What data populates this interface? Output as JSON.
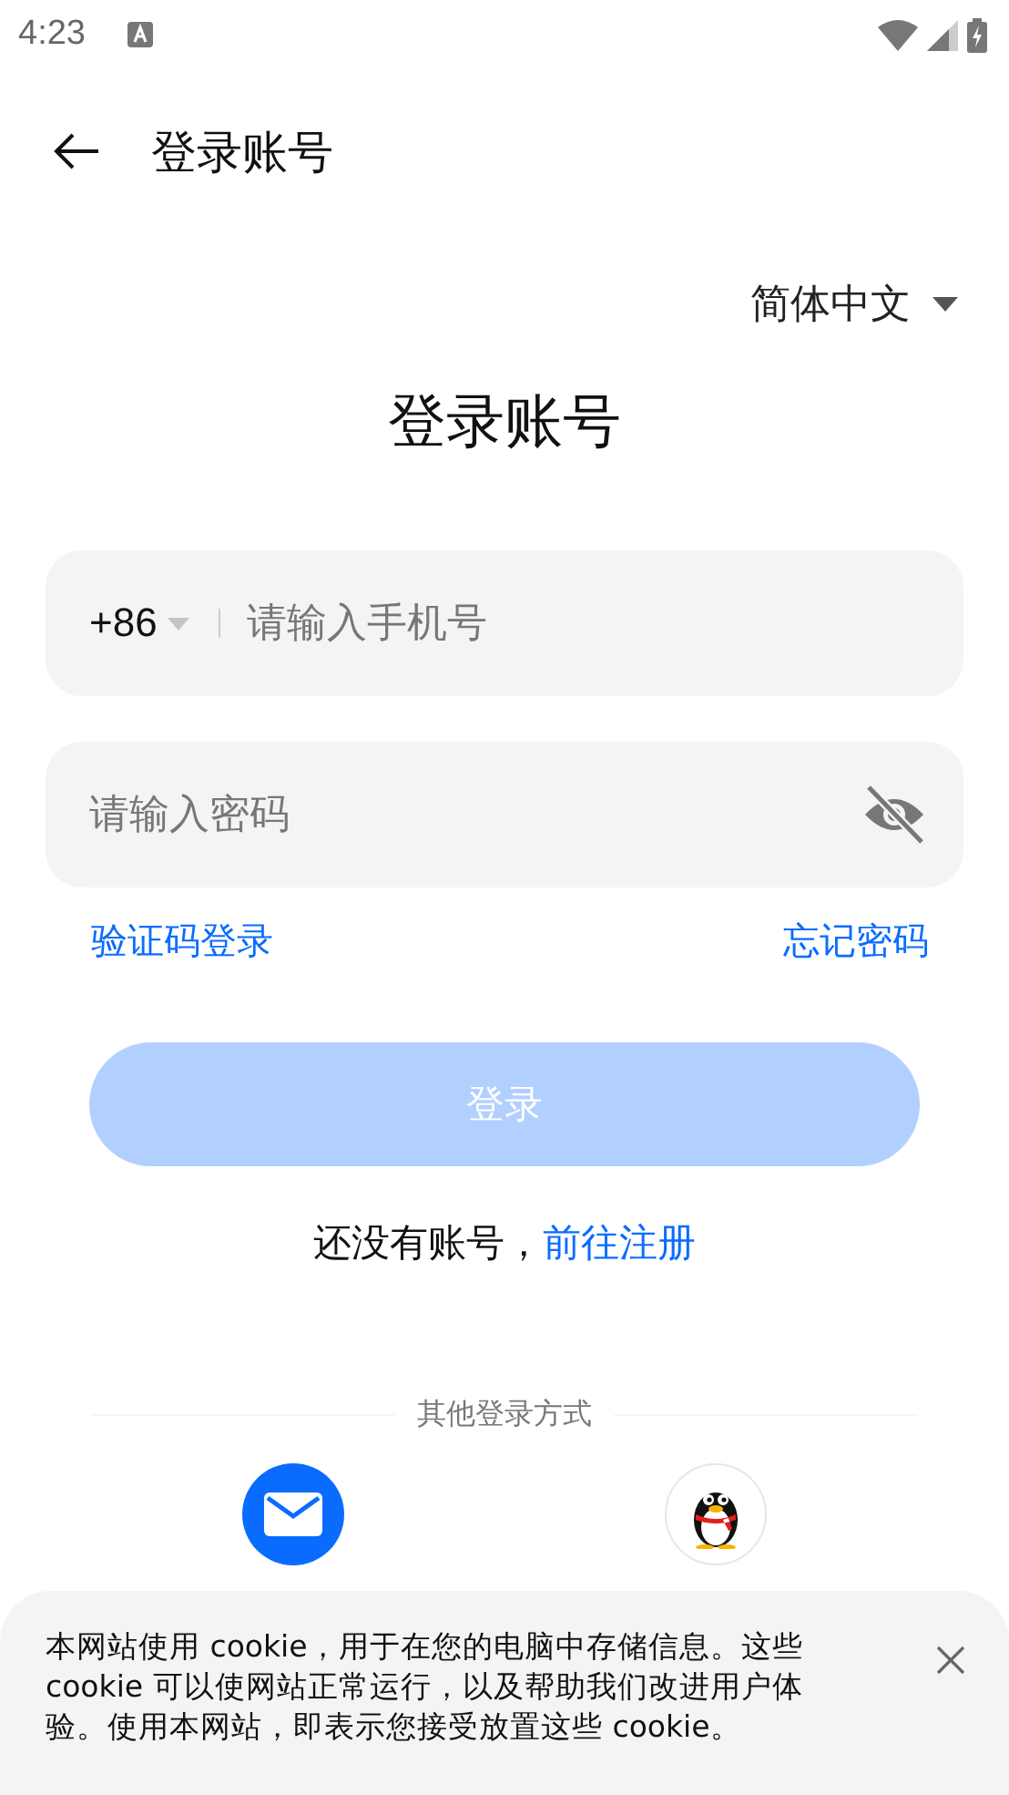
{
  "status_bar": {
    "time": "4:23"
  },
  "header": {
    "title": "登录账号"
  },
  "language": {
    "label": "简体中文"
  },
  "title": "登录账号",
  "phone": {
    "country_code": "+86",
    "placeholder": "请输入手机号"
  },
  "password": {
    "placeholder": "请输入密码",
    "visible": false
  },
  "links": [
    "验证码登录",
    "忘记密码"
  ],
  "login_button": {
    "label": "登录",
    "disabled": true
  },
  "register": {
    "prompt": "还没有账号，",
    "link": "前往注册"
  },
  "other_login": {
    "label": "其他登录方式",
    "methods": [
      {
        "kind": "email"
      },
      {
        "kind": "qq"
      }
    ]
  },
  "cookie_banner": {
    "text": "本网站使用 cookie，用于在您的电脑中存储信息。这些 cookie 可以使网站正常运行，以及帮助我们改进用户体验。使用本网站，即表示您接受放置这些 cookie。"
  }
}
